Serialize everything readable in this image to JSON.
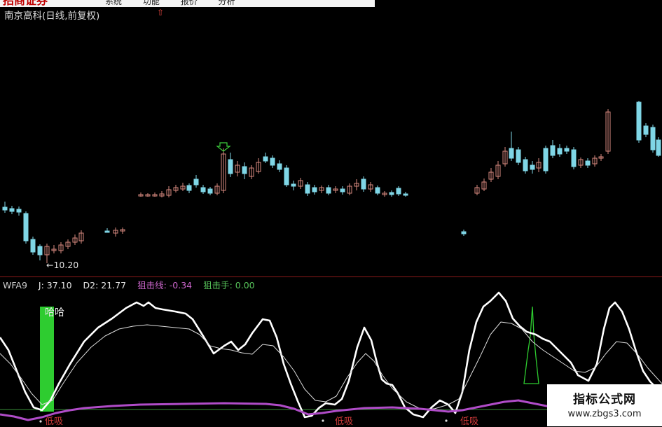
{
  "header": {
    "brand": "招商证券",
    "menu": [
      "系统",
      "功能",
      "报价",
      "分析"
    ]
  },
  "chart_title": "南京高科(日线,前复权)",
  "price_panel": {
    "low_label": "←10.20"
  },
  "indicator": {
    "name": "WFA9",
    "j_label": "J: 37.10",
    "d2_label": "D2: 21.77",
    "zjx_label": "狙击线: -0.34",
    "zjs_label": "狙击手: 0.00",
    "signal_text": "哈哈",
    "low_buy_text": "低吸"
  },
  "watermark": {
    "title": "指标公式网",
    "url": "www.zbgs3.com"
  },
  "colors": {
    "up": "#d98a80",
    "down": "#7fd6e6",
    "signal_bar": "#2ecc30",
    "line_j": "#ffffff",
    "line_zjx": "#b04cc8",
    "separator": "#8b1a1a"
  }
}
